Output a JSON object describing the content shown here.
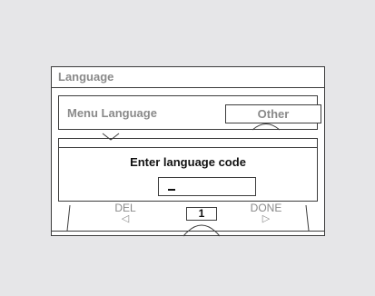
{
  "window": {
    "title": "Language"
  },
  "menu": {
    "label": "Menu Language",
    "value": "Other"
  },
  "dialog": {
    "prompt": "Enter language code",
    "input_value": ""
  },
  "controls": {
    "delete_label": "DEL",
    "done_label": "DONE",
    "digit": "1",
    "left_arrow": "◁",
    "right_arrow": "▷"
  },
  "colors": {
    "background": "#e6e6e8",
    "border": "#3c3c3c",
    "dim_text": "#8a8a8a"
  }
}
